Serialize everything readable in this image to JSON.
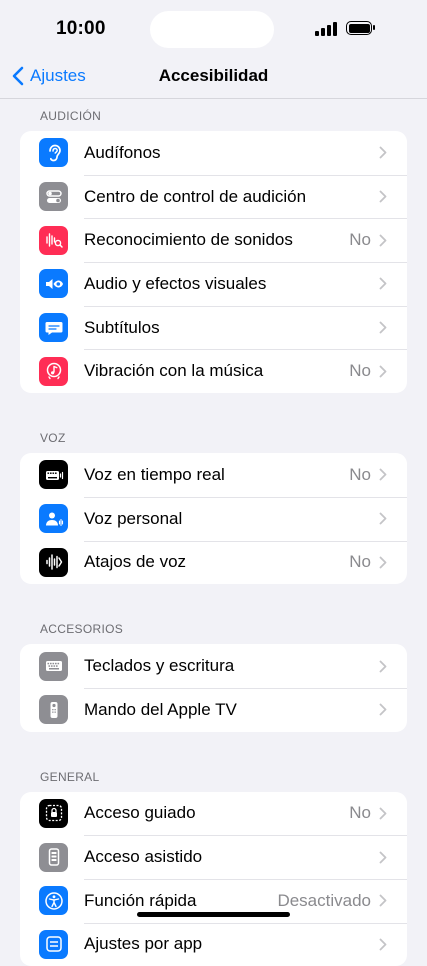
{
  "status": {
    "time": "10:00"
  },
  "nav": {
    "back_label": "Ajustes",
    "title": "Accesibilidad"
  },
  "sections": [
    {
      "header": "AUDICIÓN",
      "rows": [
        {
          "label": "Audífonos",
          "value": "",
          "icon": "ear-icon",
          "color": "#0a7aff"
        },
        {
          "label": "Centro de control de audición",
          "value": "",
          "icon": "toggles-icon",
          "color": "#8e8e93"
        },
        {
          "label": "Reconocimiento de sonidos",
          "value": "No",
          "icon": "waveform-search-icon",
          "color": "#ff2d55"
        },
        {
          "label": "Audio y efectos visuales",
          "value": "",
          "icon": "speaker-eye-icon",
          "color": "#0a7aff"
        },
        {
          "label": "Subtítulos",
          "value": "",
          "icon": "speech-bubble-icon",
          "color": "#0a7aff"
        },
        {
          "label": "Vibración con la música",
          "value": "No",
          "icon": "music-vibration-icon",
          "color": "#ff2d55"
        }
      ]
    },
    {
      "header": "VOZ",
      "rows": [
        {
          "label": "Voz en tiempo real",
          "value": "No",
          "icon": "keyboard-wave-icon",
          "color": "#000000"
        },
        {
          "label": "Voz personal",
          "value": "",
          "icon": "person-wave-icon",
          "color": "#0a7aff"
        },
        {
          "label": "Atajos de voz",
          "value": "No",
          "icon": "waveform-icon",
          "color": "#000000"
        }
      ]
    },
    {
      "header": "ACCESORIOS",
      "rows": [
        {
          "label": "Teclados y escritura",
          "value": "",
          "icon": "keyboard-icon",
          "color": "#8e8e93"
        },
        {
          "label": "Mando del Apple TV",
          "value": "",
          "icon": "remote-icon",
          "color": "#8e8e93"
        }
      ]
    },
    {
      "header": "GENERAL",
      "rows": [
        {
          "label": "Acceso guiado",
          "value": "No",
          "icon": "lock-frame-icon",
          "color": "#000000"
        },
        {
          "label": "Acceso asistido",
          "value": "",
          "icon": "assistive-phone-icon",
          "color": "#8e8e93"
        },
        {
          "label": "Función rápida",
          "value": "Desactivado",
          "icon": "accessibility-icon",
          "color": "#0a7aff"
        },
        {
          "label": "Ajustes por app",
          "value": "",
          "icon": "app-settings-icon",
          "color": "#0a7aff"
        }
      ]
    }
  ]
}
